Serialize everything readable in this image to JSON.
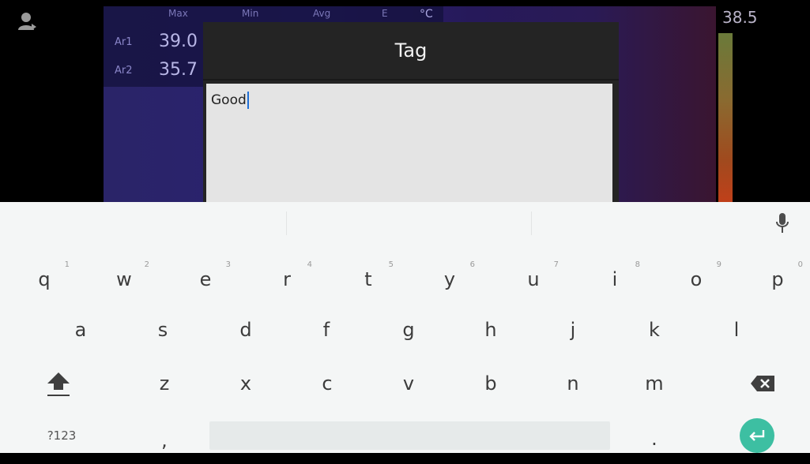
{
  "camera": {
    "stats": {
      "headers": [
        "Max",
        "Min",
        "Avg",
        "E",
        "°C"
      ],
      "rows": [
        {
          "label": "Ar1",
          "value": "39.0"
        },
        {
          "label": "Ar2",
          "value": "35.7"
        }
      ]
    },
    "scale_max": "38.5"
  },
  "dialog": {
    "title": "Tag",
    "input_value": "Good"
  },
  "keyboard": {
    "row1": [
      {
        "label": "q",
        "hint": "1"
      },
      {
        "label": "w",
        "hint": "2"
      },
      {
        "label": "e",
        "hint": "3"
      },
      {
        "label": "r",
        "hint": "4"
      },
      {
        "label": "t",
        "hint": "5"
      },
      {
        "label": "y",
        "hint": "6"
      },
      {
        "label": "u",
        "hint": "7"
      },
      {
        "label": "i",
        "hint": "8"
      },
      {
        "label": "o",
        "hint": "9"
      },
      {
        "label": "p",
        "hint": "0"
      }
    ],
    "row2": [
      "a",
      "s",
      "d",
      "f",
      "g",
      "h",
      "j",
      "k",
      "l"
    ],
    "row3": [
      "z",
      "x",
      "c",
      "v",
      "b",
      "n",
      "m"
    ],
    "symbols_label": "?123",
    "comma_label": ",",
    "period_label": ".",
    "colors": {
      "enter": "#3dbfa2",
      "caret": "#1f6fd6"
    }
  }
}
